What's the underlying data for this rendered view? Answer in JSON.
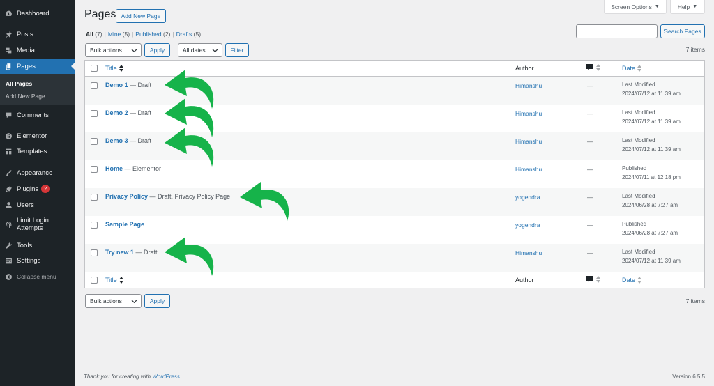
{
  "sidebar": {
    "items": [
      {
        "label": "Dashboard",
        "icon": "dashboard-icon"
      },
      {
        "label": "Posts",
        "icon": "pin-icon"
      },
      {
        "label": "Media",
        "icon": "media-icon"
      },
      {
        "label": "Pages",
        "icon": "pages-icon"
      },
      {
        "label": "Comments",
        "icon": "comment-icon"
      },
      {
        "label": "Elementor",
        "icon": "elementor-icon"
      },
      {
        "label": "Templates",
        "icon": "templates-icon"
      },
      {
        "label": "Appearance",
        "icon": "brush-icon"
      },
      {
        "label": "Plugins",
        "icon": "plug-icon",
        "badge": "2"
      },
      {
        "label": "Users",
        "icon": "user-icon"
      },
      {
        "label": "Limit Login Attempts",
        "icon": "fingerprint-icon"
      },
      {
        "label": "Tools",
        "icon": "wrench-icon"
      },
      {
        "label": "Settings",
        "icon": "settings-icon"
      }
    ],
    "submenu": [
      "All Pages",
      "Add New Page"
    ],
    "collapse_label": "Collapse menu"
  },
  "top": {
    "screen_options": "Screen Options",
    "help": "Help"
  },
  "header": {
    "title": "Pages",
    "add_new": "Add New Page"
  },
  "filters": {
    "all": "All",
    "all_count": "(7)",
    "mine": "Mine",
    "mine_count": "(5)",
    "published": "Published",
    "published_count": "(2)",
    "drafts": "Drafts",
    "drafts_count": "(5)"
  },
  "search": {
    "button": "Search Pages",
    "value": ""
  },
  "actions": {
    "bulk": "Bulk actions",
    "apply": "Apply",
    "dates": "All dates",
    "filter": "Filter",
    "items_count": "7 items"
  },
  "table": {
    "headers": {
      "title": "Title",
      "author": "Author",
      "date": "Date"
    },
    "rows": [
      {
        "title": "Demo 1",
        "state": " — Draft",
        "author": "Himanshu",
        "comments": "—",
        "status": "Last Modified",
        "date": "2024/07/12 at 11:39 am"
      },
      {
        "title": "Demo 2",
        "state": " — Draft",
        "author": "Himanshu",
        "comments": "—",
        "status": "Last Modified",
        "date": "2024/07/12 at 11:39 am"
      },
      {
        "title": "Demo 3",
        "state": " — Draft",
        "author": "Himanshu",
        "comments": "—",
        "status": "Last Modified",
        "date": "2024/07/12 at 11:39 am"
      },
      {
        "title": "Home",
        "state": " — Elementor",
        "author": "Himanshu",
        "comments": "—",
        "status": "Published",
        "date": "2024/07/11 at 12:18 pm"
      },
      {
        "title": "Privacy Policy",
        "state": " — Draft, Privacy Policy Page",
        "author": "yogendra",
        "comments": "—",
        "status": "Last Modified",
        "date": "2024/06/28 at 7:27 am"
      },
      {
        "title": "Sample Page",
        "state": "",
        "author": "yogendra",
        "comments": "—",
        "status": "Published",
        "date": "2024/06/28 at 7:27 am"
      },
      {
        "title": "Try new 1",
        "state": " — Draft",
        "author": "Himanshu",
        "comments": "—",
        "status": "Last Modified",
        "date": "2024/07/12 at 11:39 am"
      }
    ]
  },
  "footer": {
    "thanks_prefix": "Thank you for creating with ",
    "thanks_link": "WordPress",
    "thanks_suffix": ".",
    "version": "Version 6.5.5"
  },
  "colors": {
    "accent": "#2271b1",
    "sidebar": "#1d2327",
    "arrow": "#16b34a"
  }
}
